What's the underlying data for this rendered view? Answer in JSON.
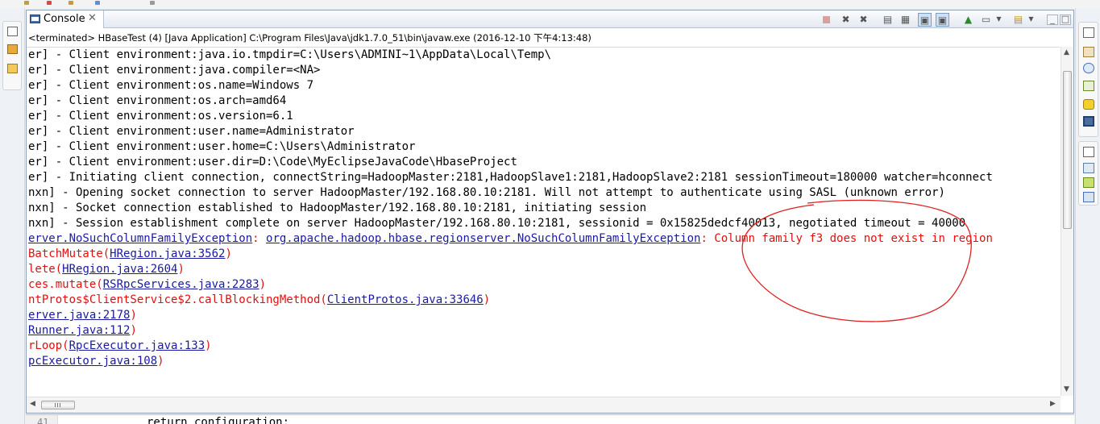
{
  "tab": {
    "label": "Console",
    "icon": "console-icon",
    "close_glyph": "✕"
  },
  "toolbar": {
    "icons": [
      "terminate-icon",
      "remove-launch-icon",
      "remove-all-terminated-icon",
      "clear-console-icon",
      "scroll-lock-icon",
      "show-on-stdout-icon",
      "show-on-stderr-icon",
      "pin-console-icon",
      "display-selected-console-icon",
      "open-console-icon"
    ]
  },
  "status_line": "<terminated> HBaseTest (4) [Java Application] C:\\Program Files\\Java\\jdk1.7.0_51\\bin\\javaw.exe (2016-12-10 下午4:13:48)",
  "output": [
    {
      "type": "plain",
      "text": "er] - Client environment:java.io.tmpdir=C:\\Users\\ADMINI~1\\AppData\\Local\\Temp\\"
    },
    {
      "type": "plain",
      "text": "er] - Client environment:java.compiler=<NA>"
    },
    {
      "type": "plain",
      "text": "er] - Client environment:os.name=Windows 7"
    },
    {
      "type": "plain",
      "text": "er] - Client environment:os.arch=amd64"
    },
    {
      "type": "plain",
      "text": "er] - Client environment:os.version=6.1"
    },
    {
      "type": "plain",
      "text": "er] - Client environment:user.name=Administrator"
    },
    {
      "type": "plain",
      "text": "er] - Client environment:user.home=C:\\Users\\Administrator"
    },
    {
      "type": "plain",
      "text": "er] - Client environment:user.dir=D:\\Code\\MyEclipseJavaCode\\HbaseProject"
    },
    {
      "type": "plain",
      "text": "er] - Initiating client connection, connectString=HadoopMaster:2181,HadoopSlave1:2181,HadoopSlave2:2181 sessionTimeout=180000 watcher=hconnect"
    },
    {
      "type": "plain",
      "text": "nxn] - Opening socket connection to server HadoopMaster/192.168.80.10:2181. Will not attempt to authenticate using SASL (unknown error)"
    },
    {
      "type": "plain",
      "text": "nxn] - Socket connection established to HadoopMaster/192.168.80.10:2181, initiating session"
    },
    {
      "type": "plain",
      "text": "nxn] - Session establishment complete on server HadoopMaster/192.168.80.10:2181, sessionid = 0x15825dedcf40013, negotiated timeout = 40000"
    }
  ],
  "exception": {
    "link1": "erver.NoSuchColumnFamilyException",
    "sep1": ": ",
    "link2": "org.apache.hadoop.hbase.regionserver.NoSuchColumnFamilyException",
    "message": ": Column family f3 does not exist in region"
  },
  "stack": [
    {
      "prefix": "BatchMutate(",
      "link": "HRegion.java:3562",
      "suffix": ")"
    },
    {
      "prefix": "lete(",
      "link": "HRegion.java:2604",
      "suffix": ")"
    },
    {
      "prefix": "ces.mutate(",
      "link": "RSRpcServices.java:2283",
      "suffix": ")"
    },
    {
      "prefix": "ntProtos$ClientService$2.callBlockingMethod(",
      "link": "ClientProtos.java:33646",
      "suffix": ")"
    },
    {
      "prefix": "",
      "link": "erver.java:2178",
      "suffix": ")"
    },
    {
      "prefix": "",
      "link": "Runner.java:112",
      "suffix": ")"
    },
    {
      "prefix": "rLoop(",
      "link": "RpcExecutor.java:133",
      "suffix": ")"
    },
    {
      "prefix": "",
      "link": "pcExecutor.java:108",
      "suffix": ")"
    }
  ],
  "editor_peek": {
    "line_number": "41",
    "code": "return configuration;"
  },
  "colors": {
    "error_text": "#e01010",
    "link_text": "#1a1aa0",
    "annotation_ring": "#e02020"
  }
}
